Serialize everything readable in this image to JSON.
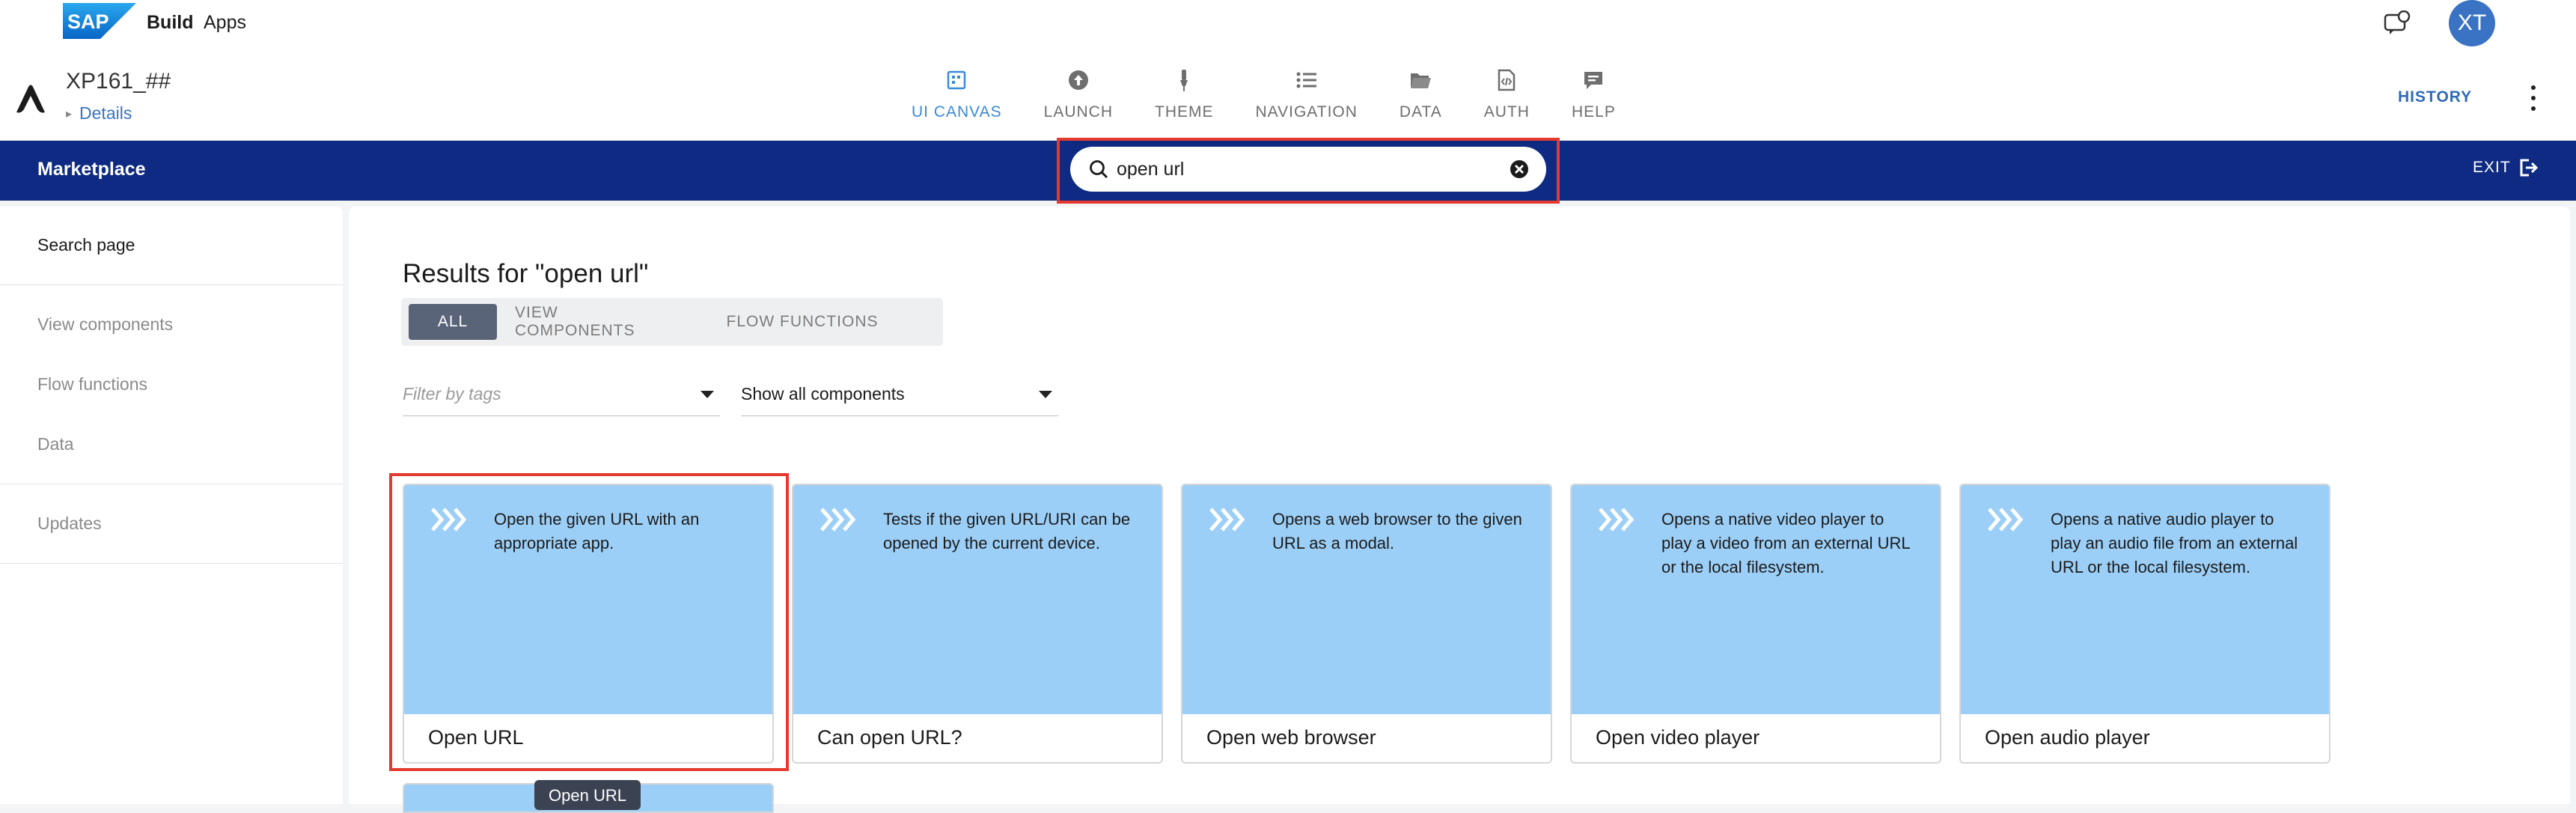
{
  "topbar": {
    "brand_logo": "SAP",
    "brand_build": "Build",
    "brand_apps": "Apps",
    "avatar_initials": "XT"
  },
  "app_header": {
    "app_name": "XP161_##",
    "details_label": "Details",
    "nav": [
      {
        "label": "UI CANVAS",
        "icon": "canvas-icon",
        "active": true
      },
      {
        "label": "LAUNCH",
        "icon": "upload-icon"
      },
      {
        "label": "THEME",
        "icon": "brush-icon"
      },
      {
        "label": "NAVIGATION",
        "icon": "list-icon"
      },
      {
        "label": "DATA",
        "icon": "folder-icon"
      },
      {
        "label": "AUTH",
        "icon": "code-file-icon"
      },
      {
        "label": "HELP",
        "icon": "help-chat-icon"
      }
    ],
    "history_label": "HISTORY"
  },
  "marketplace_bar": {
    "title": "Marketplace",
    "search_value": "open url",
    "exit_label": "EXIT"
  },
  "sidebar": {
    "items": [
      {
        "label": "Search page",
        "active": true
      },
      {
        "label": "View components"
      },
      {
        "label": "Flow functions"
      },
      {
        "label": "Data"
      },
      {
        "label": "Updates"
      }
    ]
  },
  "main": {
    "results_title": "Results for \"open url\"",
    "tabs": [
      "ALL",
      "VIEW COMPONENTS",
      "FLOW FUNCTIONS"
    ],
    "filter_tags_placeholder": "Filter by tags",
    "components_select": "Show all components",
    "cards": [
      {
        "title": "Open URL",
        "description": "Open the given URL with an appropriate app."
      },
      {
        "title": "Can open URL?",
        "description": "Tests if the given URL/URI can be opened by the current device."
      },
      {
        "title": "Open web browser",
        "description": "Opens a web browser to the given URL as a modal."
      },
      {
        "title": "Open video player",
        "description": "Opens a native video player to play a video from an external URL or the local filesystem."
      },
      {
        "title": "Open audio player",
        "description": "Opens a native audio player to play an audio file from an external URL or the local filesystem."
      }
    ],
    "tooltip": "Open URL"
  },
  "colors": {
    "marketplace_bar": "#0e2a83",
    "card_preview": "#9ccff7",
    "highlight": "#e53b2e",
    "active_tab": "#5a6478",
    "accent": "#3a8ad6"
  }
}
